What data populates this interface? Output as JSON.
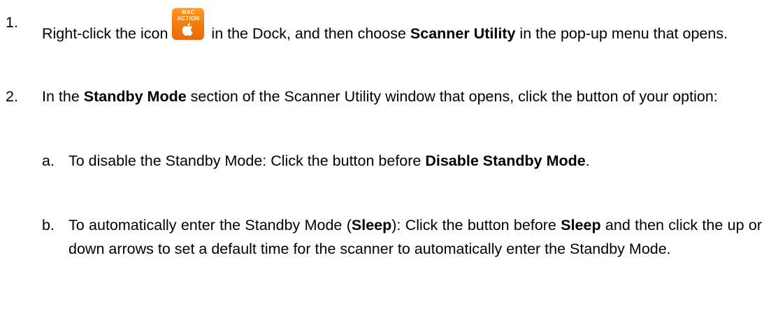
{
  "steps": [
    {
      "number": "1.",
      "text_before_icon": "Right-click the icon",
      "icon": {
        "name": "mac-action-icon",
        "label_line1": "MAC",
        "label_line2": "ACTION"
      },
      "text_after_icon": " in the Dock, and then choose ",
      "bold_1": "Scanner Utility",
      "text_end": " in the pop-up menu that opens."
    },
    {
      "number": "2.",
      "text_before": "In the ",
      "bold_1": "Standby Mode",
      "text_after": " section of the Scanner Utility window that opens, click the button of your option:",
      "substeps": [
        {
          "letter": "a.",
          "text_before": "To disable the Standby Mode: Click the button before ",
          "bold_1": "Disable Standby Mode",
          "text_end": "."
        },
        {
          "letter": "b.",
          "text_before": "To automatically enter the Standby Mode (",
          "bold_1": "Sleep",
          "text_middle": "): Click the button before ",
          "bold_2": "Sleep",
          "text_end": " and then click the up or down arrows to set a default time for the scanner to automatically enter the Standby Mode."
        }
      ]
    }
  ],
  "colors": {
    "icon_orange": "#f47a0c",
    "text": "#000000"
  }
}
